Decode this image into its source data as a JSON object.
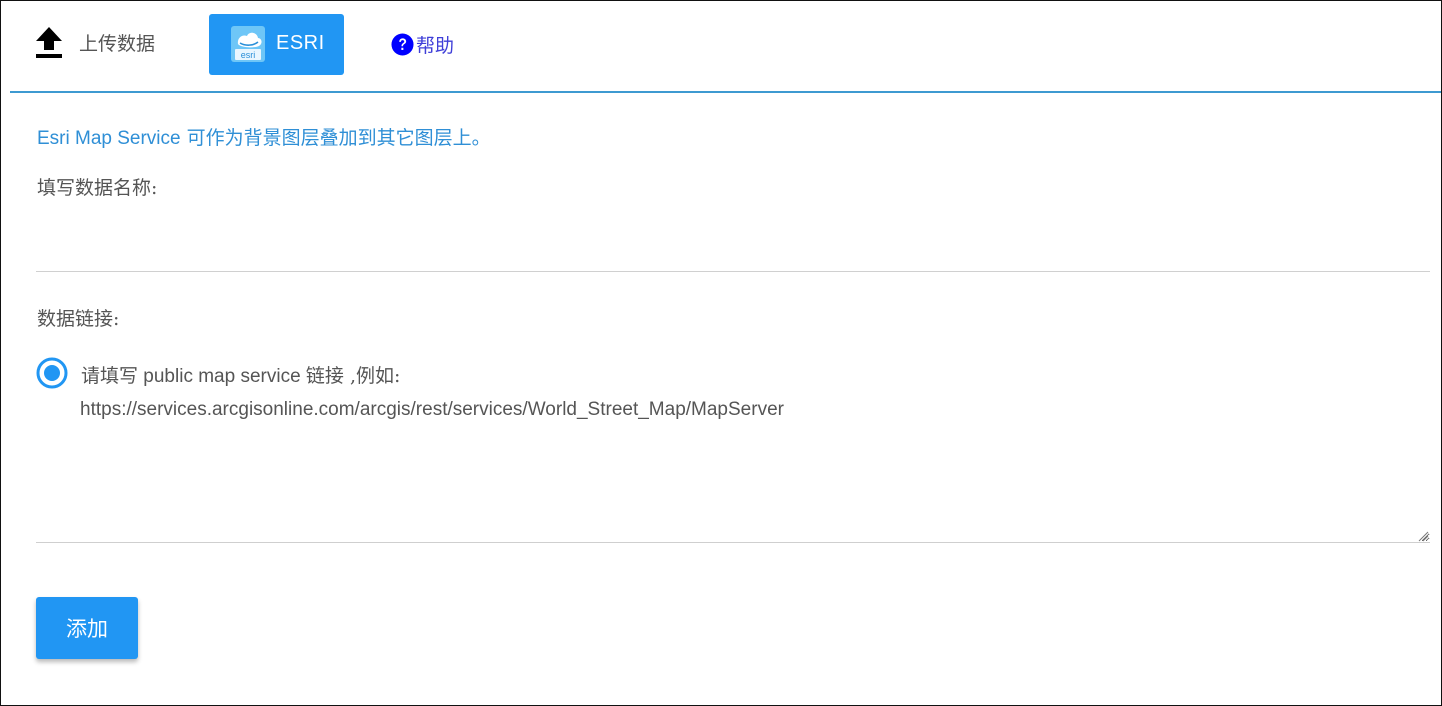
{
  "tabs": {
    "upload": {
      "label": "上传数据",
      "icon": "upload-icon"
    },
    "esri": {
      "label": "ESRI",
      "icon": "esri-logo-icon",
      "active": true
    },
    "help": {
      "label": "帮助",
      "icon": "help-circle-icon"
    }
  },
  "intro": {
    "service_name": "Esri Map Service",
    "text": " 可作为背景图层叠加到其它图层上。"
  },
  "form": {
    "name_label": "填写数据名称:",
    "name_value": "",
    "link_label": "数据链接:",
    "radio_hint_prefix": "请填写",
    "radio_hint_service": " public map service ",
    "radio_hint_suffix": "链接 ,例如:",
    "radio_selected": true,
    "url_example": "https://services.arcgisonline.com/arcgis/rest/services/World_Street_Map/MapServer",
    "add_label": "添加"
  },
  "colors": {
    "accent": "#2196f3",
    "link_blue": "#2f8fd6",
    "help_blue": "#0000ff",
    "divider": "#3d9ad1"
  }
}
